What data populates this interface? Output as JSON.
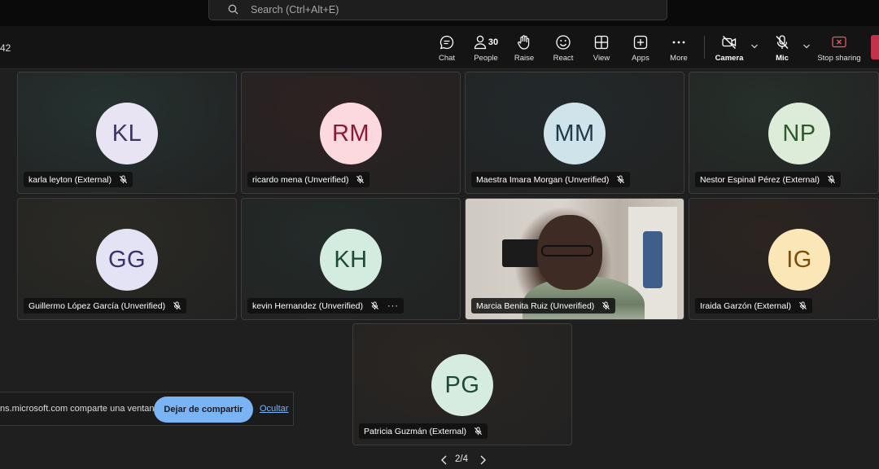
{
  "search": {
    "placeholder": "Search (Ctrl+Alt+E)"
  },
  "meeting": {
    "timer": "42"
  },
  "toolbar": {
    "chat": "Chat",
    "people": "People",
    "people_count": "30",
    "raise": "Raise",
    "react": "React",
    "view": "View",
    "apps": "Apps",
    "more": "More",
    "camera": "Camera",
    "mic": "Mic",
    "stop_sharing": "Stop sharing"
  },
  "participants": [
    {
      "initials": "KL",
      "name": "karla leyton (External)",
      "avatar_bg": "#e8e4f4",
      "avatar_fg": "#3d3561",
      "tile_tint": "#253230"
    },
    {
      "initials": "RM",
      "name": "ricardo mena (Unverified)",
      "avatar_bg": "#fbd9de",
      "avatar_fg": "#8a1b33",
      "tile_tint": "#2e2222"
    },
    {
      "initials": "MM",
      "name": "Maestra Imara Morgan (Unverified)",
      "avatar_bg": "#cfe4ea",
      "avatar_fg": "#1f3b4a",
      "tile_tint": "#22292b"
    },
    {
      "initials": "NP",
      "name": "Nestor Espinal Pérez (External)",
      "avatar_bg": "#dcecd9",
      "avatar_fg": "#2d5a29",
      "tile_tint": "#26302a"
    },
    {
      "initials": "GG",
      "name": "Guillermo López García (Unverified)",
      "avatar_bg": "#e4e3f5",
      "avatar_fg": "#36346a",
      "tile_tint": "#2b2a24"
    },
    {
      "initials": "KH",
      "name": "kevin Hernandez (Unverified)",
      "avatar_bg": "#d3ecdf",
      "avatar_fg": "#1c4a34",
      "tile_tint": "#232b29"
    },
    {
      "initials": "",
      "name": "Marcia Benita Ruiz (Unverified)",
      "avatar_bg": "",
      "avatar_fg": "",
      "tile_tint": "#aaa59c"
    },
    {
      "initials": "IG",
      "name": "Iraida Garzón (External)",
      "avatar_bg": "#fbe6b8",
      "avatar_fg": "#7a4d08",
      "tile_tint": "#2c2421"
    },
    {
      "initials": "PG",
      "name": "Patricia Guzmán (External)",
      "avatar_bg": "#d7ece1",
      "avatar_fg": "#1c4a32",
      "tile_tint": "#2b2622"
    }
  ],
  "share_bar": {
    "message": "ns.microsoft.com comparte una ventana.",
    "stop_label": "Dejar de compartir",
    "hide_label": "Ocultar"
  },
  "pager": {
    "label": "2/4"
  }
}
